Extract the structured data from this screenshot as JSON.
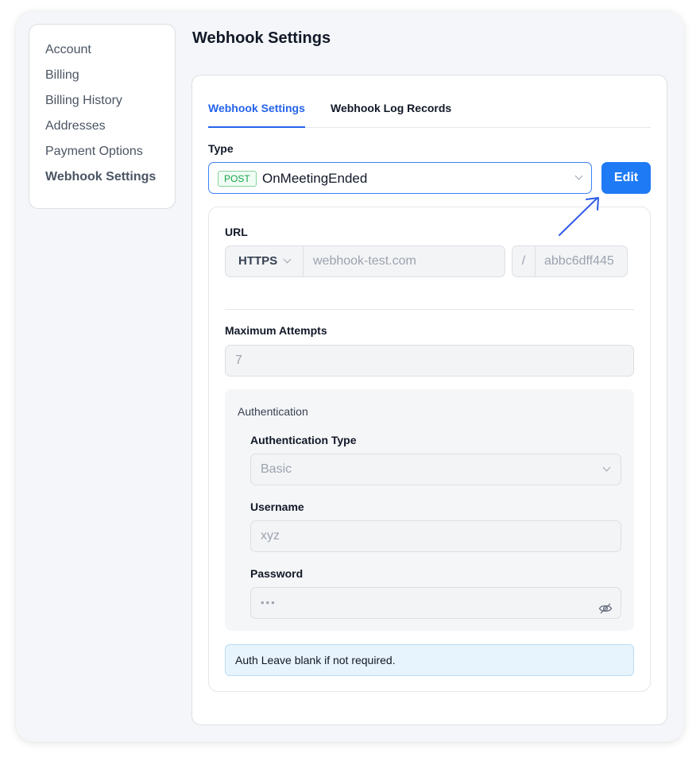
{
  "sidebar": {
    "items": [
      {
        "label": "Account"
      },
      {
        "label": "Billing"
      },
      {
        "label": "Billing History"
      },
      {
        "label": "Addresses"
      },
      {
        "label": "Payment Options"
      },
      {
        "label": "Webhook Settings",
        "active": true
      }
    ]
  },
  "page": {
    "title": "Webhook Settings"
  },
  "tabs": [
    {
      "label": "Webhook Settings",
      "active": true
    },
    {
      "label": "Webhook Log Records"
    }
  ],
  "type": {
    "label": "Type",
    "method_badge": "POST",
    "value": "OnMeetingEnded",
    "edit_label": "Edit"
  },
  "url": {
    "label": "URL",
    "scheme": "HTTPS",
    "host": "webhook-test.com",
    "separator": "/",
    "path": "abbc6dff445"
  },
  "max_attempts": {
    "label": "Maximum Attempts",
    "value": "7"
  },
  "authentication": {
    "section_label": "Authentication",
    "type_label": "Authentication Type",
    "type_value": "Basic",
    "username_label": "Username",
    "username_value": "xyz",
    "password_label": "Password",
    "password_value": "•••"
  },
  "notice": {
    "text": "Auth Leave blank if not required."
  },
  "colors": {
    "accent": "#1f7af5",
    "post_badge": "#16a34a",
    "annotation_arrow": "#2f5be8"
  }
}
